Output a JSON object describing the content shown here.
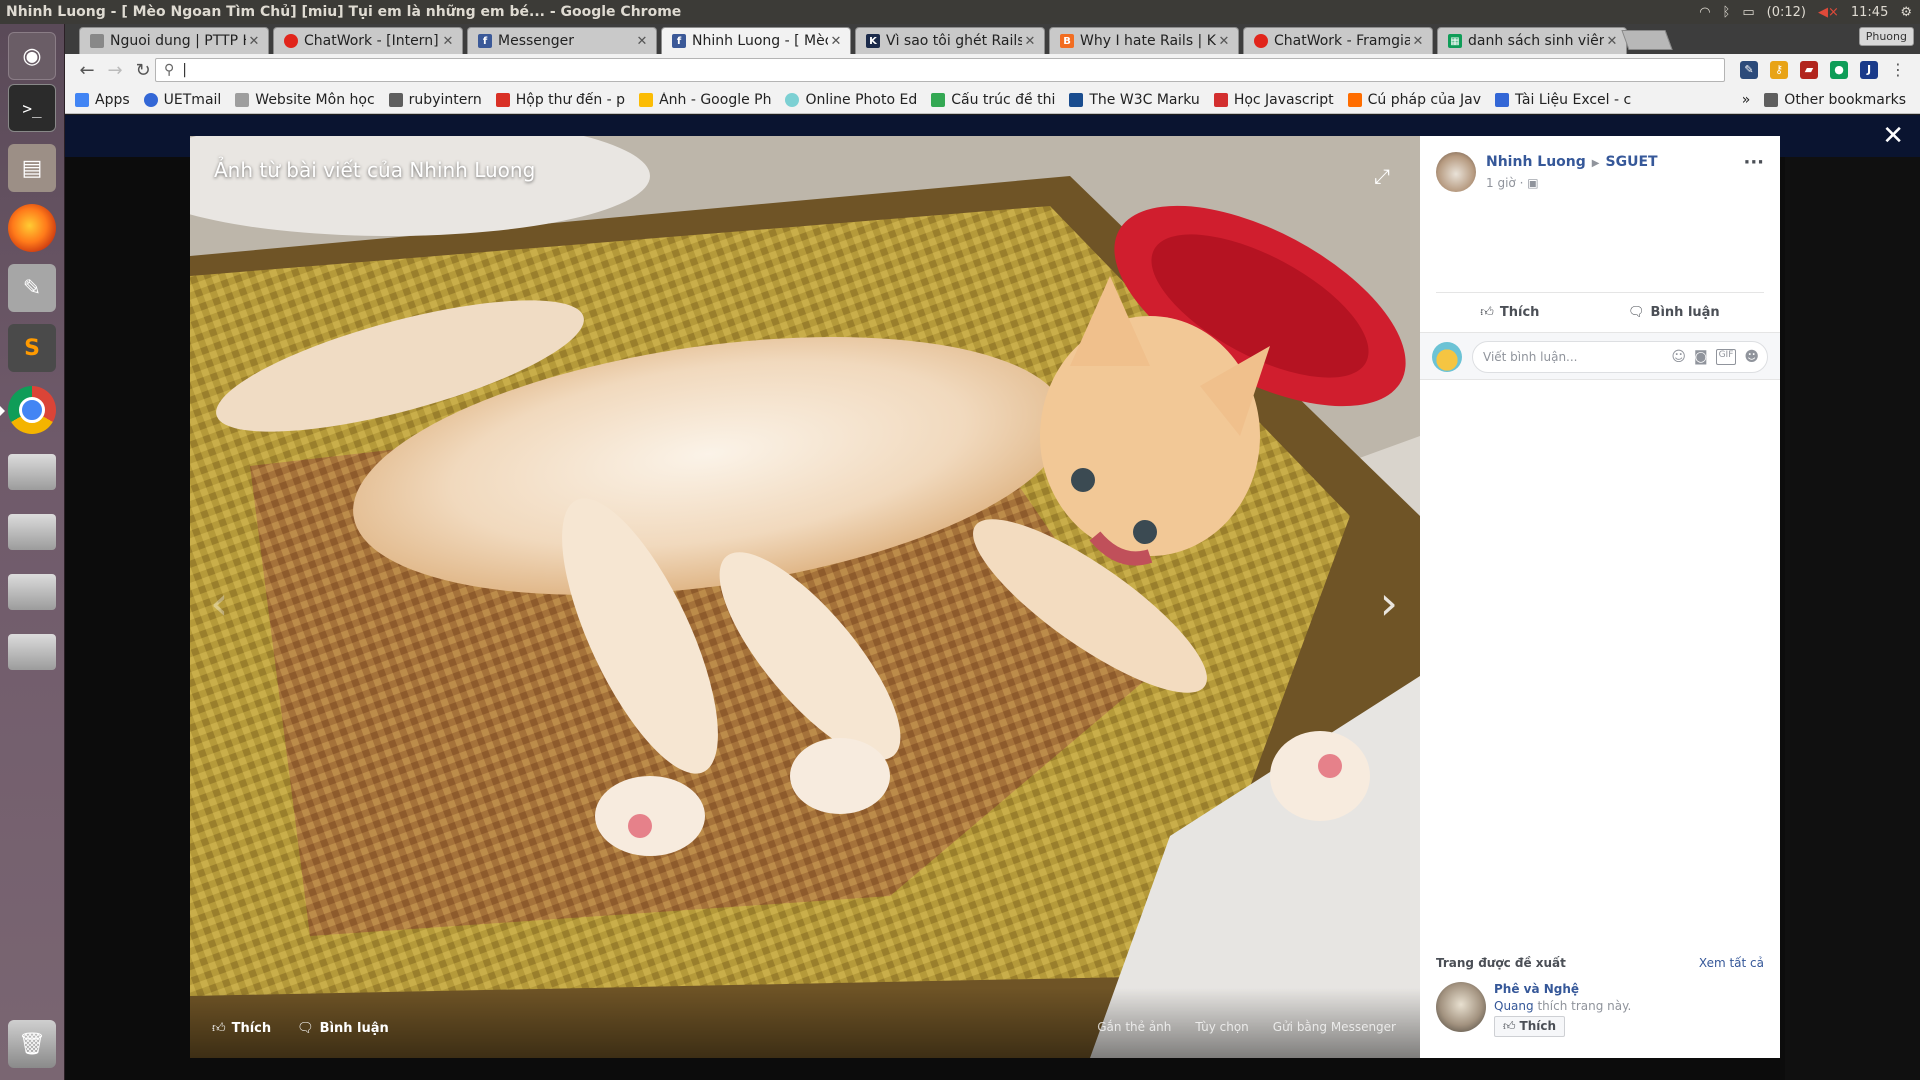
{
  "window": {
    "title": "Nhinh Luong - [ Mèo Ngoan Tìm Chủ] [miu] Tụi em là những em bé... - Google Chrome",
    "tray": {
      "battery": "(0:12)",
      "clock": "11:45"
    }
  },
  "tabs": [
    {
      "title": "Nguoi dung | PTTP H",
      "color": "#888888"
    },
    {
      "title": "ChatWork - [Intern]",
      "color": "#e1251b"
    },
    {
      "title": "Messenger",
      "color": "#3b5998"
    },
    {
      "title": "Nhinh Luong - [ Mèo",
      "color": "#3b5998",
      "active": true
    },
    {
      "title": "Vì sao tôi ghét Rails",
      "color": "#1b2a4a"
    },
    {
      "title": "Why I hate Rails | Ka",
      "color": "#f26d21"
    },
    {
      "title": "ChatWork - Framgia",
      "color": "#e1251b"
    },
    {
      "title": "danh sách sinh viên",
      "color": "#0f9d58"
    }
  ],
  "profile_name": "Phuong",
  "omnibox": {
    "value": "|"
  },
  "bookmarks": [
    {
      "label": "Apps",
      "color": "#4285f4"
    },
    {
      "label": "UETmail",
      "color": "#3367d6"
    },
    {
      "label": "Website Môn học",
      "color": "#9e9e9e"
    },
    {
      "label": "rubyintern",
      "color": "#5f5f5f"
    },
    {
      "label": "Hộp thư đến - p",
      "color": "#d93025"
    },
    {
      "label": "Ảnh - Google Ph",
      "color": "#fbbc04"
    },
    {
      "label": "Online Photo Ed",
      "color": "#7cd0d3"
    },
    {
      "label": "Cấu trúc đề thi",
      "color": "#34a853"
    },
    {
      "label": "The W3C Marku",
      "color": "#1a4d8f"
    },
    {
      "label": "Học Javascript",
      "color": "#d32f2f"
    },
    {
      "label": "Cú pháp của Jav",
      "color": "#ff6d00"
    },
    {
      "label": "Tài Liệu Excel - c",
      "color": "#3367d6"
    }
  ],
  "bookmarks_overflow": "»",
  "other_bookmarks": "Other bookmarks",
  "photo": {
    "title": "Ảnh từ bài viết của Nhinh Luong",
    "like": "Thích",
    "comment": "Bình luận",
    "tag": "Gắn thẻ ảnh",
    "options": "Tùy chọn",
    "send": "Gửi bằng Messenger"
  },
  "post": {
    "author": "Nhinh Luong",
    "group": "SGUET",
    "time": "1 giờ",
    "like": "Thích",
    "comment": "Bình luận",
    "comment_placeholder": "Viết bình luận..."
  },
  "suggested": {
    "heading": "Trang được đề xuất",
    "see_all": "Xem tất cả",
    "page_name": "Phê và Nghệ",
    "friend": "Quang",
    "liked_text": "thích trang này.",
    "like": "Thích"
  }
}
